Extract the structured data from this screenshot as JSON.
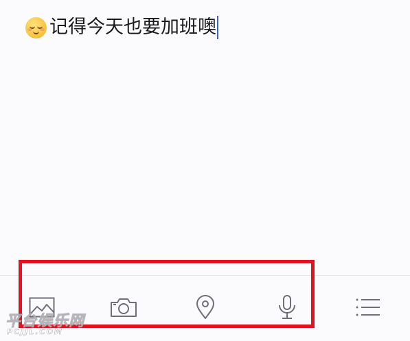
{
  "editor": {
    "emoji": "relieved-face-emoji",
    "text": "记得今天也要加班噢"
  },
  "toolbar": {
    "tools": [
      {
        "name": "image-icon"
      },
      {
        "name": "camera-icon"
      },
      {
        "name": "location-pin-icon"
      },
      {
        "name": "microphone-icon"
      },
      {
        "name": "list-icon"
      }
    ],
    "highlight_color": "#e0141e"
  },
  "watermark": {
    "main": "平台娱乐网",
    "sub": "PCJJL.COM"
  },
  "colors": {
    "background": "#fbfafc",
    "caret": "#3a5fd8",
    "icon": "#6f6f78"
  }
}
